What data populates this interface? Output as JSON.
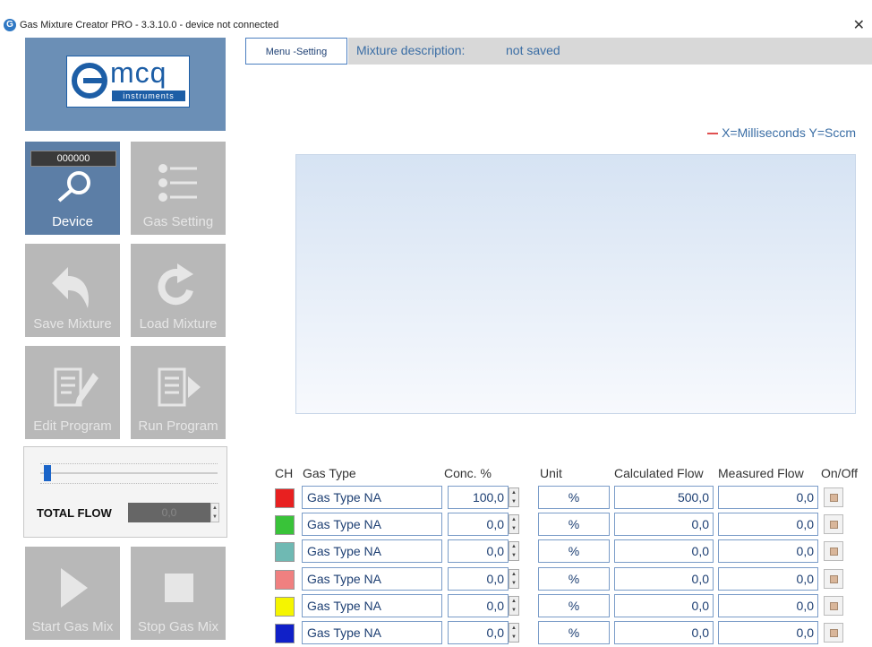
{
  "window": {
    "title": "Gas Mixture Creator PRO - 3.3.10.0 - device not connected",
    "close_glyph": "✕"
  },
  "logo": {
    "text": "mcq",
    "subtext": "instruments"
  },
  "sidebar": {
    "device": {
      "counter": "000000",
      "label": "Device",
      "icon": "magnifier-icon"
    },
    "gas_setting": {
      "label": "Gas Setting",
      "icon": "list-icon"
    },
    "save_mixture": {
      "label": "Save Mixture",
      "icon": "undo-arrow-icon"
    },
    "load_mixture": {
      "label": "Load Mixture",
      "icon": "refresh-icon"
    },
    "edit_program": {
      "label": "Edit Program",
      "icon": "edit-document-icon"
    },
    "run_program": {
      "label": "Run Program",
      "icon": "run-document-icon"
    },
    "total_flow": {
      "label": "TOTAL FLOW",
      "value": "0,0",
      "slider_fraction": 0.02
    },
    "start_gas_mix": {
      "label": "Start Gas Mix",
      "icon": "play-icon"
    },
    "stop_gas_mix": {
      "label": "Stop Gas Mix",
      "icon": "stop-icon"
    }
  },
  "header": {
    "menu_button": "Menu -Setting",
    "mixture_label": "Mixture description:",
    "mixture_value": "not saved"
  },
  "chart": {
    "legend": "X=Milliseconds Y=Sccm",
    "legend_color": "#e05050"
  },
  "grid": {
    "headers": {
      "ch": "CH",
      "gas_type": "Gas Type",
      "conc": "Conc. %",
      "unit": "Unit",
      "calc_flow": "Calculated Flow",
      "meas_flow": "Measured Flow",
      "onoff": "On/Off"
    },
    "rows": [
      {
        "color": "#e82020",
        "gas": "Gas Type NA",
        "conc": "100,0",
        "unit": "%",
        "calc": "500,0",
        "meas": "0,0"
      },
      {
        "color": "#39c339",
        "gas": "Gas Type NA",
        "conc": "0,0",
        "unit": "%",
        "calc": "0,0",
        "meas": "0,0"
      },
      {
        "color": "#6fb9b3",
        "gas": "Gas Type NA",
        "conc": "0,0",
        "unit": "%",
        "calc": "0,0",
        "meas": "0,0"
      },
      {
        "color": "#f08080",
        "gas": "Gas Type NA",
        "conc": "0,0",
        "unit": "%",
        "calc": "0,0",
        "meas": "0,0"
      },
      {
        "color": "#f5f500",
        "gas": "Gas Type NA",
        "conc": "0,0",
        "unit": "%",
        "calc": "0,0",
        "meas": "0,0"
      },
      {
        "color": "#1020c8",
        "gas": "Gas Type NA",
        "conc": "0,0",
        "unit": "%",
        "calc": "0,0",
        "meas": "0,0"
      }
    ]
  }
}
